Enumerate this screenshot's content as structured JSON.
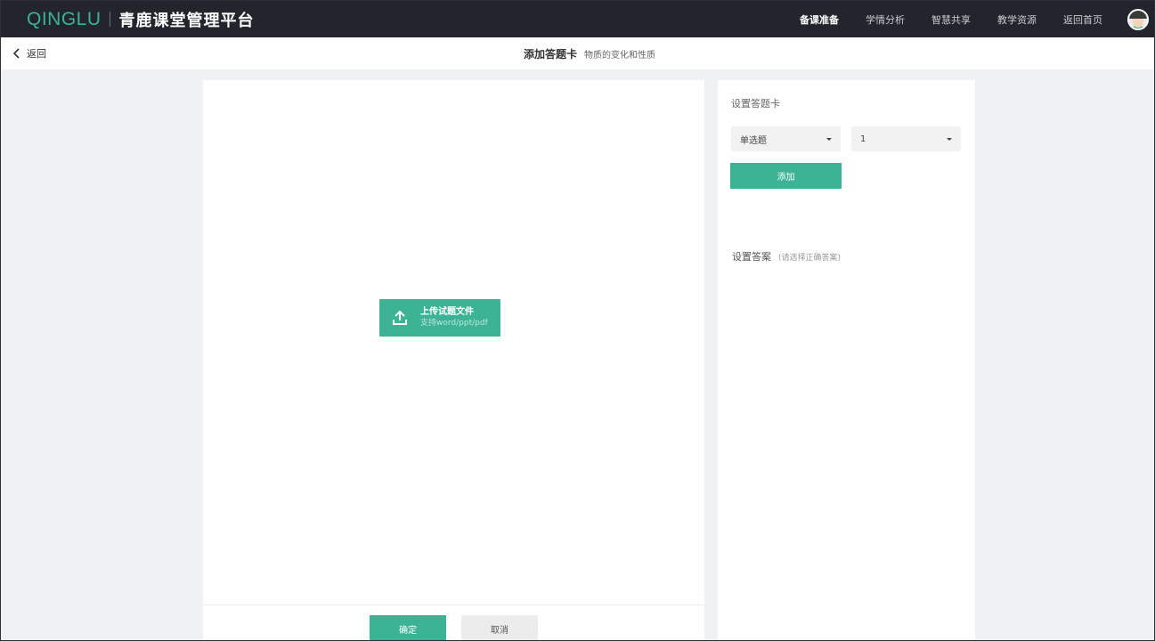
{
  "brand": {
    "latin": "QINGLU",
    "chinese": "青鹿课堂管理平台"
  },
  "nav": {
    "items": [
      {
        "label": "备课准备",
        "active": true
      },
      {
        "label": "学情分析",
        "active": false
      },
      {
        "label": "智慧共享",
        "active": false
      },
      {
        "label": "教学资源",
        "active": false
      },
      {
        "label": "返回首页",
        "active": false
      }
    ],
    "avatar_icon": "user-avatar-icon"
  },
  "subbar": {
    "back_label": "返回",
    "title": "添加答题卡",
    "subtitle": "物质的变化和性质"
  },
  "upload": {
    "title": "上传试题文件",
    "hint": "支持word/ppt/pdf",
    "icon": "upload-icon"
  },
  "footer": {
    "confirm_label": "确定",
    "cancel_label": "取消"
  },
  "answer_card": {
    "title": "设置答题卡",
    "type_value": "单选题",
    "count_value": "1",
    "add_label": "添加",
    "answer_title": "设置答案",
    "answer_hint": "(请选择正确答案)"
  },
  "colors": {
    "accent": "#3bb394",
    "topbar": "#22252c",
    "background": "#f0f1f3"
  }
}
